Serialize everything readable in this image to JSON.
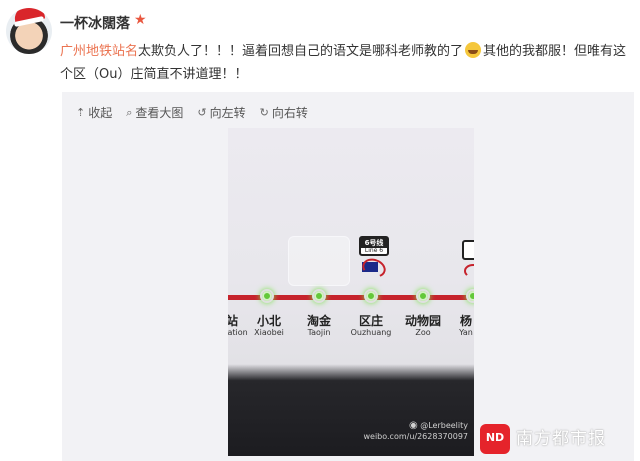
{
  "post": {
    "user_name": "一杯冰闊落",
    "topic": "广州地铁站名",
    "text_part1": "太欺负人了！！！逼着回想自己的语文是哪科老师教的了",
    "text_part2": "其他的我都服！但唯有这个区（Ou）庄简直不讲道理！！"
  },
  "toolbar": {
    "collapse": "收起",
    "view_large": "查看大图",
    "rotate_left": "向左转",
    "rotate_right": "向右转"
  },
  "photo": {
    "stations": [
      {
        "cn": "站",
        "en": "tation"
      },
      {
        "cn": "小北",
        "en": "Xiaobei"
      },
      {
        "cn": "淘金",
        "en": "Taojin"
      },
      {
        "cn": "区庄",
        "en": "Ouzhuang"
      },
      {
        "cn": "动物园",
        "en": "Zoo"
      },
      {
        "cn": "杨",
        "en": "Yan"
      }
    ],
    "line_badge": "6号线",
    "line_badge_en": "Line 6",
    "watermark_handle": "@Lerbeelity",
    "watermark_url": "weibo.com/u/2628370097"
  },
  "source": {
    "logo_text": "ND",
    "label": "南方都市报"
  },
  "colors": {
    "topic": "#eb7350",
    "metro_line": "#c6232c",
    "station_light": "#64c83a"
  }
}
